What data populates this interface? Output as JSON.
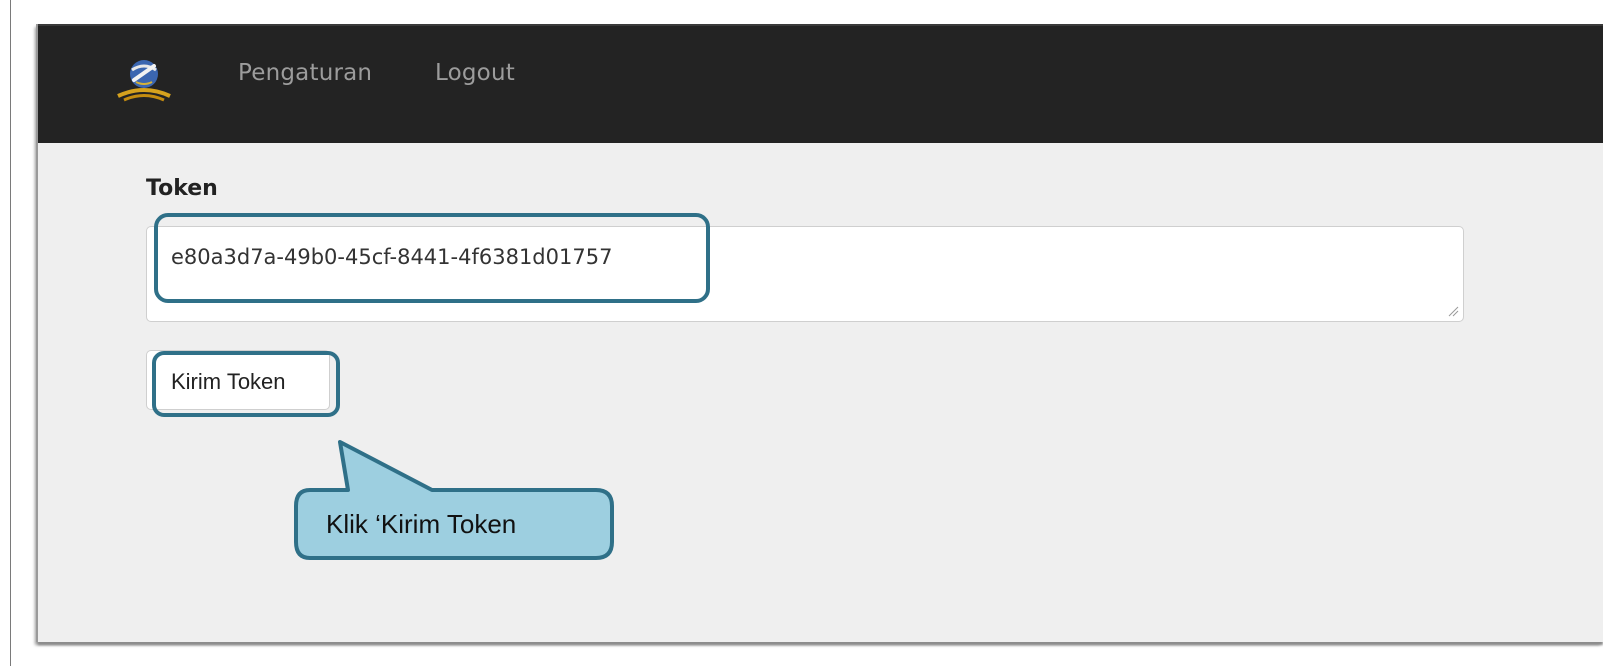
{
  "navbar": {
    "logo_icon": "emblem-logo-icon",
    "links": [
      {
        "label": "Pengaturan"
      },
      {
        "label": "Logout"
      }
    ]
  },
  "form": {
    "token_label": "Token",
    "token_value": "e80a3d7a-49b0-45cf-8441-4f6381d01757",
    "submit_label": "Kirim Token"
  },
  "annotation": {
    "callout_text": "Klik ‘Kirim Token",
    "highlight_color": "#2f7088",
    "callout_fill": "#9dcfe0"
  },
  "colors": {
    "navbar_bg": "#232323",
    "page_bg": "#efefef",
    "nav_link": "#9c9c9c"
  }
}
